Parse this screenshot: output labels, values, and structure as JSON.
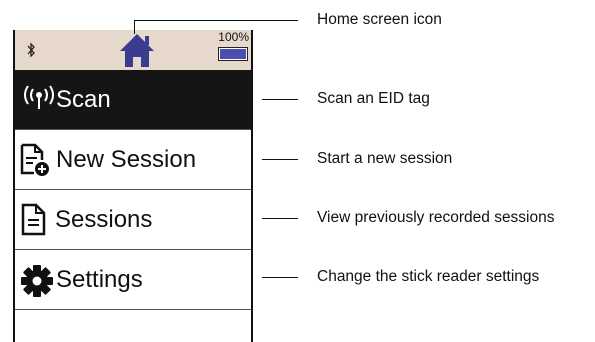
{
  "device": {
    "status_bar": {
      "battery_label": "100%",
      "battery_level": 1.0,
      "background_color": "#e7d8cc",
      "home_icon_color": "#3b3b8f",
      "battery_fill_color": "#4d4db0"
    },
    "menu": [
      {
        "label": "Scan",
        "icon": "antenna-icon",
        "selected": true
      },
      {
        "label": "New Session",
        "icon": "new-document-icon",
        "selected": false
      },
      {
        "label": "Sessions",
        "icon": "document-icon",
        "selected": false
      },
      {
        "label": "Settings",
        "icon": "gear-icon",
        "selected": false
      }
    ]
  },
  "callouts": {
    "home": "Home screen icon",
    "scan": "Scan an EID tag",
    "new_session": "Start a new session",
    "sessions": "View previously recorded sessions",
    "settings": "Change the stick reader settings"
  }
}
